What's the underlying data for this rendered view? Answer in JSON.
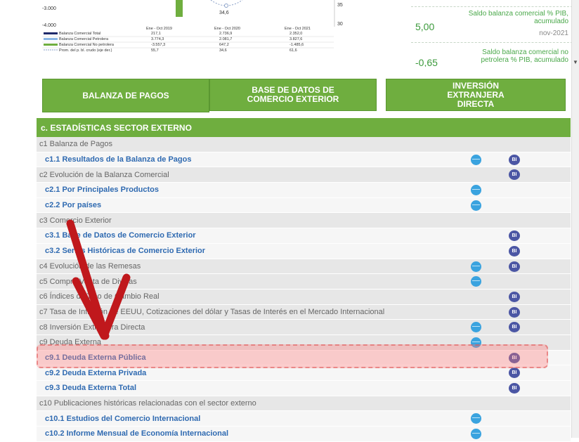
{
  "chart": {
    "y_ticks": [
      "-3.000",
      "-4.000"
    ],
    "right_ticks": [
      "35",
      "30"
    ],
    "circle_value": "34,6",
    "col_heads": [
      "Ene - Oct 2019",
      "Ene - Oct 2020",
      "Ene - Oct 2021"
    ],
    "rows": [
      {
        "label": "Balanza Comercial Total",
        "v1": "217,1",
        "v2": "2.736,9",
        "v3": "2.352,0"
      },
      {
        "label": "Balanza Comercial Petrolera",
        "v1": "3.774,3",
        "v2": "2.081,7",
        "v3": "3.827,6"
      },
      {
        "label": "Balanza Comercial No petrolera",
        "v1": "-3.557,3",
        "v2": "647,2",
        "v3": "-1.485,6"
      },
      {
        "label": "Prom. del p. bl. crudo (eje der.)",
        "v1": "55,7",
        "v2": "34,6",
        "v3": "61,6"
      }
    ],
    "colors": {
      "total": "#1f2a6b",
      "petrolera": "#8ab6e6",
      "no_petrolera": "#6fae3f",
      "promedio": "#8aa0c8"
    }
  },
  "kpis": [
    {
      "value": "5,00",
      "label": "Saldo balanza comercial % PIB, acumulado",
      "date": "nov-2021"
    },
    {
      "value": "-0,65",
      "label": "Saldo balanza comercial no petrolera % PIB, acumulado",
      "date": ""
    }
  ],
  "buttons": [
    "BALANZA DE PAGOS",
    "BASE DE DATOS DE COMERCIO EXTERIOR",
    "INVERSIÓN EXTRANJERA DIRECTA"
  ],
  "panel_title": "c. ESTADÍSTICAS SECTOR EXTERNO",
  "rows": [
    {
      "type": "cat",
      "text": "c1 Balanza de Pagos",
      "globe": false,
      "bi": false
    },
    {
      "type": "item",
      "text": "c1.1 Resultados de la Balanza de Pagos",
      "globe": true,
      "bi": true
    },
    {
      "type": "cat",
      "text": "c2 Evolución de la Balanza Comercial",
      "globe": false,
      "bi": true
    },
    {
      "type": "item",
      "text": "c2.1 Por Principales Productos",
      "globe": true,
      "bi": false
    },
    {
      "type": "item",
      "text": "c2.2 Por países",
      "globe": true,
      "bi": false
    },
    {
      "type": "cat",
      "text": "c3 Comercio Exterior",
      "globe": false,
      "bi": false
    },
    {
      "type": "item",
      "text": "c3.1 Base de Datos de Comercio Exterior",
      "globe": false,
      "bi": true
    },
    {
      "type": "item",
      "text": "c3.2 Series Históricas de Comercio Exterior",
      "globe": false,
      "bi": true
    },
    {
      "type": "cat",
      "text": "c4 Evolución de las Remesas",
      "globe": true,
      "bi": true
    },
    {
      "type": "cat",
      "text": "c5 Compra Venta de Divisas",
      "globe": true,
      "bi": false
    },
    {
      "type": "cat",
      "text": "c6 Índices de Tipo de Cambio Real",
      "globe": false,
      "bi": true
    },
    {
      "type": "cat",
      "text": "c7 Tasa de Inflación de EEUU, Cotizaciones del dólar y Tasas de Interés en el Mercado Internacional",
      "globe": false,
      "bi": true
    },
    {
      "type": "cat",
      "text": "c8 Inversión Extranjera Directa",
      "globe": true,
      "bi": true
    },
    {
      "type": "cat",
      "text": "c9 Deuda Externa",
      "globe": true,
      "bi": false
    },
    {
      "type": "item",
      "text": "c9.1 Deuda Externa Pública",
      "globe": false,
      "bi": true
    },
    {
      "type": "item",
      "text": "c9.2 Deuda Externa Privada",
      "globe": false,
      "bi": true
    },
    {
      "type": "item",
      "text": "c9.3 Deuda Externa Total",
      "globe": false,
      "bi": true
    },
    {
      "type": "cat",
      "text": "c10 Publicaciones históricas relacionadas con el sector externo",
      "globe": false,
      "bi": false
    },
    {
      "type": "item",
      "text": "c10.1 Estudios del Comercio Internacional",
      "globe": true,
      "bi": false
    },
    {
      "type": "item",
      "text": "c10.2 Informe Mensual de Economía Internacional",
      "globe": true,
      "bi": false
    }
  ],
  "bi_label": "BI",
  "icons": {
    "globe": "globe-icon",
    "bi": "bi-icon"
  }
}
